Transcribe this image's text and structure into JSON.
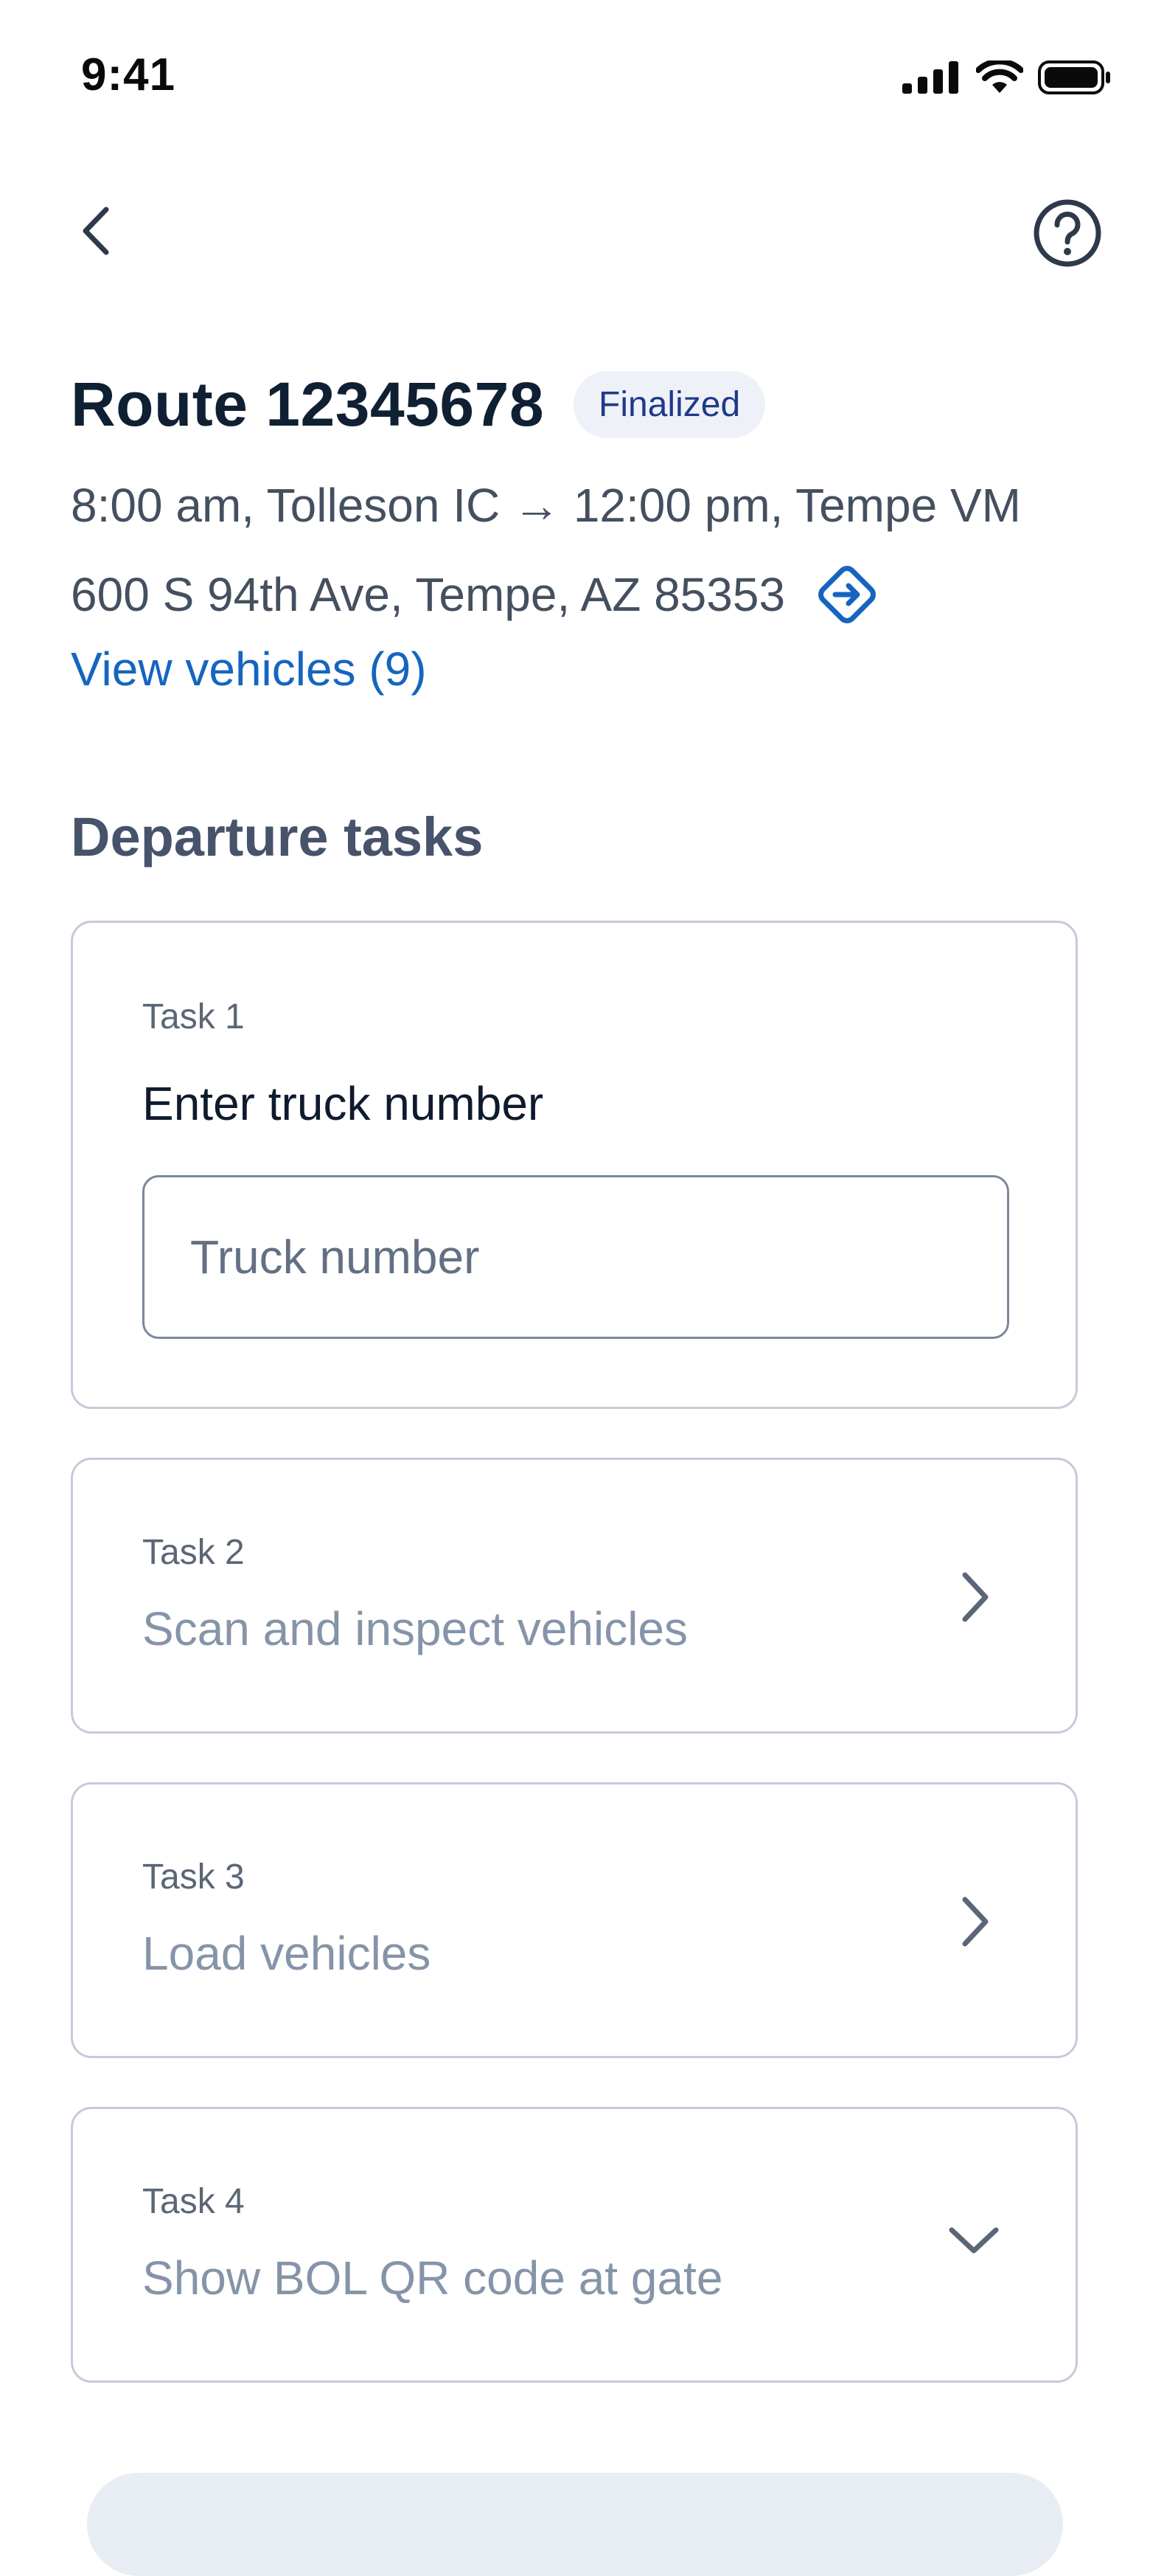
{
  "status_bar": {
    "time": "9:41"
  },
  "header": {
    "route_title": "Route 12345678",
    "status_badge": "Finalized",
    "schedule": "8:00 am, Tolleson IC → 12:00 pm, Tempe VM",
    "address": "600 S 94th Ave, Tempe, AZ 85353",
    "view_vehicles_label": "View vehicles (9)"
  },
  "section": {
    "title": "Departure tasks"
  },
  "tasks": [
    {
      "label": "Task 1",
      "title": "Enter truck number",
      "input_placeholder": "Truck number",
      "input_value": ""
    },
    {
      "label": "Task 2",
      "title": "Scan and inspect vehicles",
      "icon": "chevron-right-icon"
    },
    {
      "label": "Task 3",
      "title": "Load vehicles",
      "icon": "chevron-right-icon"
    },
    {
      "label": "Task 4",
      "title": "Show BOL QR code at gate",
      "icon": "chevron-down-icon"
    }
  ],
  "colors": {
    "link": "#1565c0",
    "badge_bg": "#eef2f8",
    "badge_text": "#1f3a8a",
    "card_border": "#c3ccd8"
  }
}
